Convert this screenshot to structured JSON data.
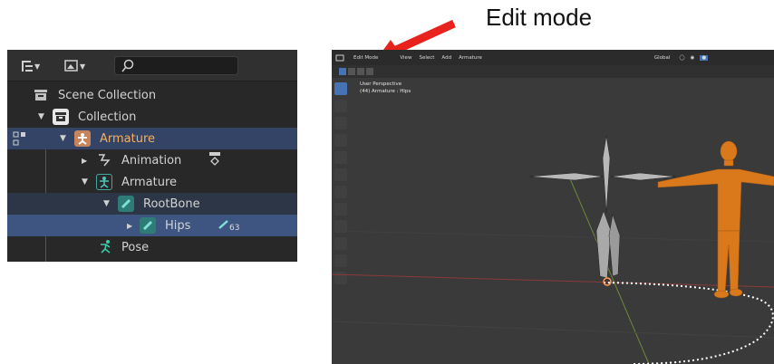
{
  "annotation": {
    "label": "Edit mode",
    "arrow_color": "#e8221c"
  },
  "outliner": {
    "search": {
      "placeholder": "",
      "value": ""
    },
    "items": [
      {
        "label": "Scene Collection",
        "icon": "scene-collection-icon"
      },
      {
        "label": "Collection",
        "icon": "collection-icon"
      },
      {
        "label": "Armature",
        "icon": "armature-object-icon",
        "color": "#f4b060"
      },
      {
        "label": "Animation",
        "icon": "animation-icon"
      },
      {
        "label": "Armature",
        "icon": "armature-data-icon"
      },
      {
        "label": "RootBone",
        "icon": "bone-icon"
      },
      {
        "label": "Hips",
        "icon": "bone-icon",
        "badge": "63"
      },
      {
        "label": "Pose",
        "icon": "pose-icon"
      }
    ]
  },
  "viewport": {
    "header": {
      "mode": "Edit Mode",
      "menus": [
        "View",
        "Select",
        "Add",
        "Armature"
      ],
      "orientation": "Global"
    },
    "info": {
      "line1": "User Perspective",
      "line2": "(44) Armature : Hips"
    },
    "colors": {
      "background": "#3a3a3a",
      "x_axis": "#8a3a3a",
      "y_axis": "#6d8a3a",
      "figure": "#d9791c",
      "active_tool": "#4772b3"
    }
  }
}
